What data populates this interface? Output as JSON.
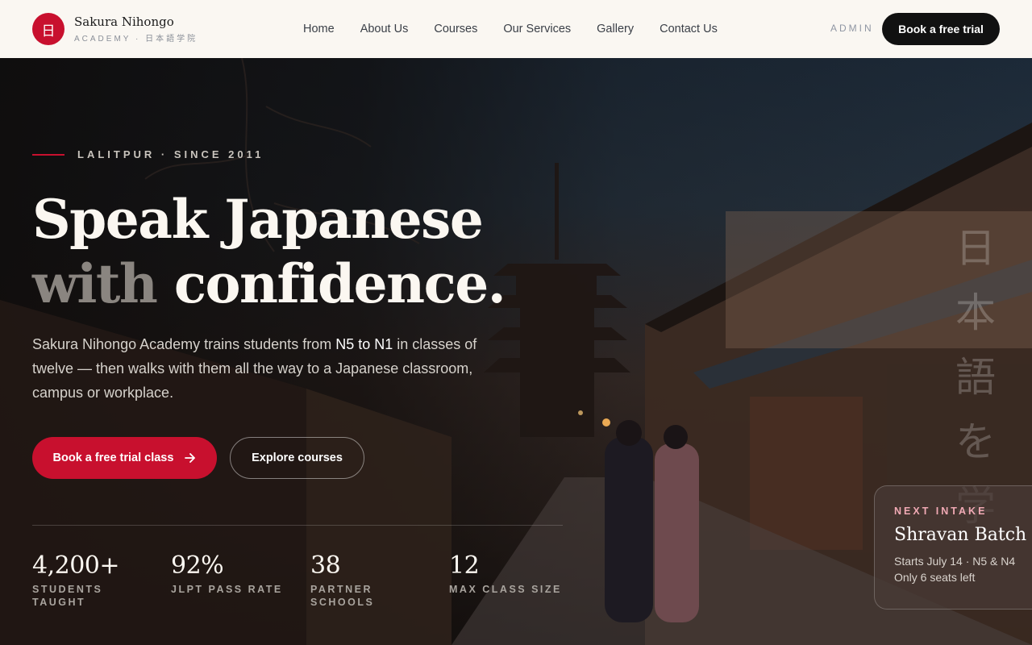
{
  "brand": {
    "mark": "日",
    "name": "Sakura Nihongo",
    "subtitle": "ACADEMY · 日本語学院"
  },
  "nav": {
    "items": [
      "Home",
      "About Us",
      "Courses",
      "Our Services",
      "Gallery",
      "Contact Us"
    ],
    "admin": "ADMIN",
    "cta": "Book a free trial"
  },
  "hero": {
    "kicker": "LALITPUR · SINCE 2011",
    "headline_line1": "Speak Japanese",
    "headline_dim": "with",
    "headline_rest": " confidence.",
    "lead_before": "Sakura Nihongo Academy trains students from ",
    "lead_highlight": "N5 to N1",
    "lead_after": " in classes of twelve — then walks with them all the way to a Japanese classroom, campus or workplace.",
    "primary_cta": "Book a free trial class",
    "primary_icon": "arrow-right-icon",
    "secondary_cta": "Explore courses",
    "vertical_text": [
      "日",
      "本",
      "語",
      "を",
      "学"
    ]
  },
  "stats": [
    {
      "value": "4,200+",
      "label_line1": "STUDENTS",
      "label_line2": "TAUGHT"
    },
    {
      "value": "92%",
      "label_line1": "JLPT PASS RATE",
      "label_line2": ""
    },
    {
      "value": "38",
      "label_line1": "PARTNER",
      "label_line2": "SCHOOLS"
    },
    {
      "value": "12",
      "label_line1": "MAX CLASS SIZE",
      "label_line2": ""
    }
  ],
  "intake": {
    "kicker": "NEXT INTAKE",
    "title": "Shravan Batch",
    "detail": "Starts July 14 · N5 & N4",
    "seats": "Only 6 seats left"
  },
  "colors": {
    "accent": "#c8102e",
    "header_bg": "#faf7f2",
    "dark_button": "#111111"
  }
}
